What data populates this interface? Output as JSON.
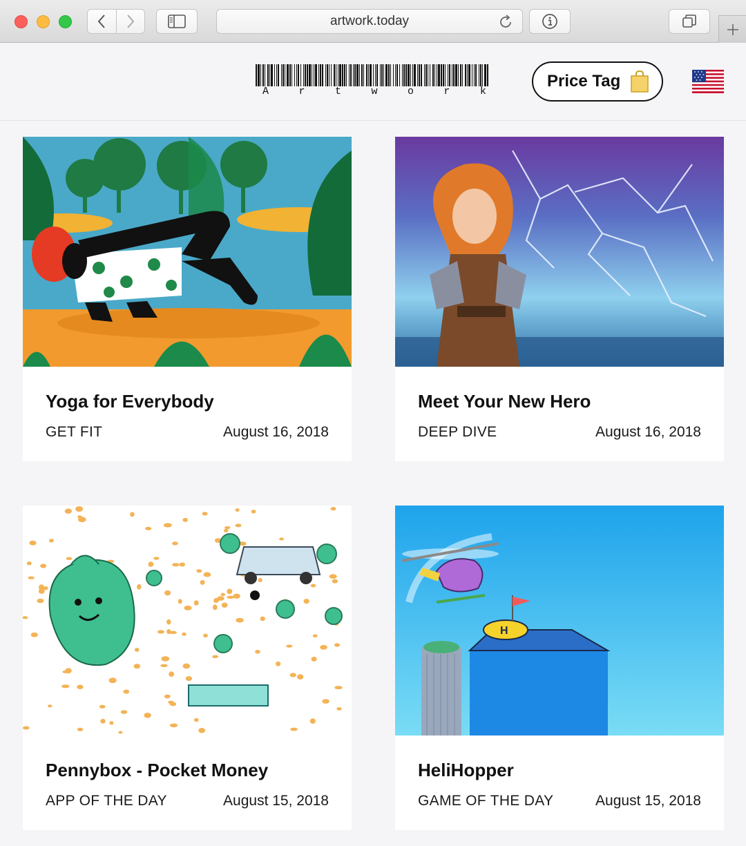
{
  "browser": {
    "url": "artwork.today"
  },
  "header": {
    "logo_text": [
      "A",
      "r",
      "t",
      "w",
      "o",
      "r",
      "k"
    ],
    "price_tag_label": "Price Tag",
    "flag_icon": "us-flag-icon"
  },
  "cards": [
    {
      "title": "Yoga for Everybody",
      "category": "GET FIT",
      "date": "August 16, 2018"
    },
    {
      "title": "Meet Your New Hero",
      "category": "DEEP DIVE",
      "date": "August 16, 2018"
    },
    {
      "title": "Pennybox - Pocket Money",
      "category": "APP OF THE DAY",
      "date": "August 15, 2018"
    },
    {
      "title": "HeliHopper",
      "category": "GAME OF THE DAY",
      "date": "August 15, 2018"
    }
  ],
  "colors": {
    "page_bg": "#f5f5f7",
    "card_bg": "#ffffff",
    "text": "#111111"
  }
}
